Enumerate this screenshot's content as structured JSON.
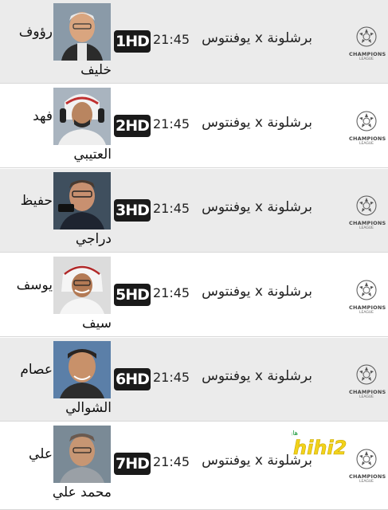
{
  "rows": [
    {
      "match": "برشلونة x يوفنتوس",
      "time": "21:45",
      "channel": "1HD",
      "commentator_first": "رؤوف",
      "commentator_last": "خليف",
      "league_name": "CHAMPIONS",
      "league_sub": "LEAGUE"
    },
    {
      "match": "برشلونة x يوفنتوس",
      "time": "21:45",
      "channel": "2HD",
      "commentator_first": "فهد",
      "commentator_last": "العتيبي",
      "league_name": "CHAMPIONS",
      "league_sub": "LEAGUE"
    },
    {
      "match": "برشلونة x يوفنتوس",
      "time": "21:45",
      "channel": "3HD",
      "commentator_first": "حفيظ",
      "commentator_last": "دراجي",
      "league_name": "CHAMPIONS",
      "league_sub": "LEAGUE"
    },
    {
      "match": "برشلونة x يوفنتوس",
      "time": "21:45",
      "channel": "5HD",
      "commentator_first": "يوسف",
      "commentator_last": "سيف",
      "league_name": "CHAMPIONS",
      "league_sub": "LEAGUE"
    },
    {
      "match": "برشلونة x يوفنتوس",
      "time": "21:45",
      "channel": "6HD",
      "commentator_first": "عصام",
      "commentator_last": "الشوالي",
      "league_name": "CHAMPIONS",
      "league_sub": "LEAGUE"
    },
    {
      "match": "برشلونة x يوفنتوس",
      "time": "21:45",
      "channel": "7HD",
      "commentator_first": "علي",
      "commentator_last": "محمد علي",
      "league_name": "CHAMPIONS",
      "league_sub": "LEAGUE"
    }
  ],
  "watermark": {
    "text": "hihi2",
    "sub": "هاي كورة"
  },
  "colors": {
    "row_grey": "#ebebeb",
    "row_white": "#ffffff",
    "channel_bg": "#1a1a1a",
    "watermark_yellow": "#f2d21b"
  }
}
